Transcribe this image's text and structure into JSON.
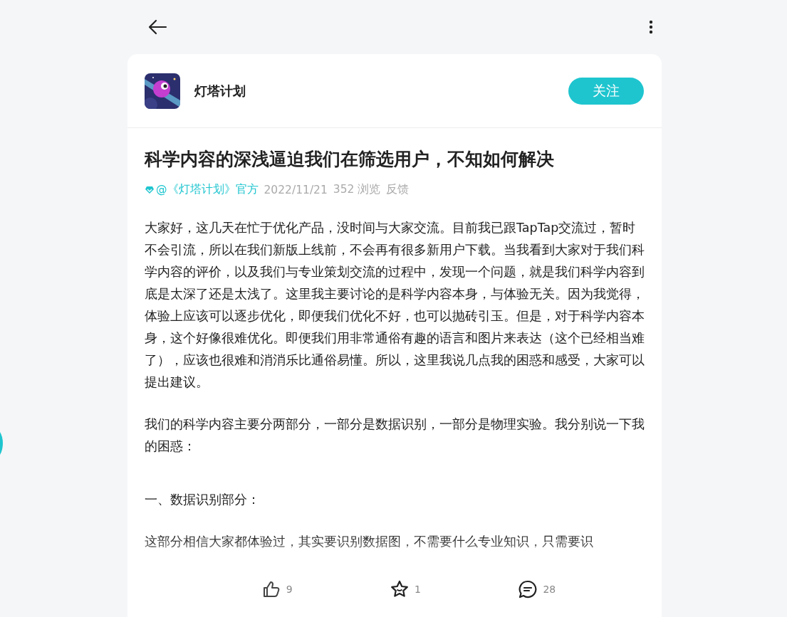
{
  "author": {
    "name": "灯塔计划"
  },
  "follow_button": {
    "label": "关注"
  },
  "post": {
    "title": "科学内容的深浅逼迫我们在筛选用户，不知如何解决",
    "author_tag": "@《灯塔计划》官方",
    "date": "2022/11/21",
    "views": "352 浏览",
    "feedback": "反馈",
    "paragraphs": [
      {
        "kind": "text",
        "text": "大家好，这几天在忙于优化产品，没时间与大家交流。目前我已跟TapTap交流过，暂时不会引流，所以在我们新版上线前，不会再有很多新用户下载。当我看到大家对于我们科学内容的评价，以及我们与专业策划交流的过程中，发现一个问题，就是我们科学内容到底是太深了还是太浅了。这里我主要讨论的是科学内容本身，与体验无关。因为我觉得，体验上应该可以逐步优化，即便我们优化不好，也可以抛砖引玉。但是，对于科学内容本身，这个好像很难优化。即便我们用非常通俗有趣的语言和图片来表达（这个已经相当难了），应该也很难和消消乐比通俗易懂。所以，这里我说几点我的困惑和感受，大家可以提出建议。"
      },
      {
        "kind": "text",
        "text": "我们的科学内容主要分两部分，一部分是数据识别，一部分是物理实验。我分别说一下我的困惑："
      },
      {
        "kind": "heading",
        "text": "一、数据识别部分："
      },
      {
        "kind": "text",
        "text": "这部分相信大家都体验过，其实要识别数据图，不需要什么专业知识，只需要识"
      }
    ]
  },
  "actions": [
    {
      "kind": "like",
      "count": "9"
    },
    {
      "kind": "favorite",
      "count": "1"
    },
    {
      "kind": "comment",
      "count": "28"
    }
  ]
}
